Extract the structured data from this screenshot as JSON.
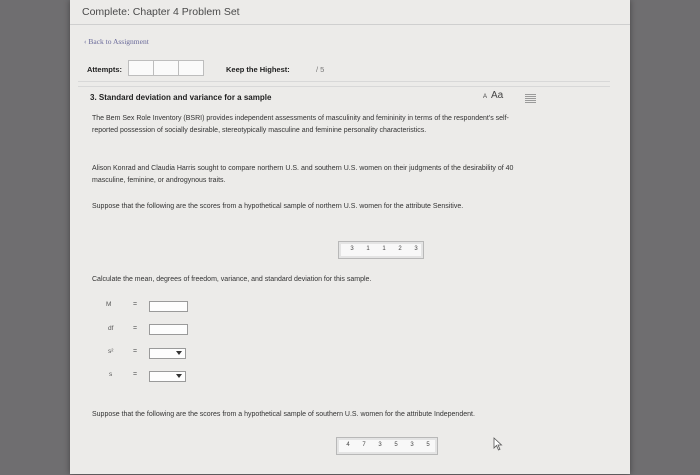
{
  "header": {
    "title": "Complete: Chapter 4 Problem Set"
  },
  "nav": {
    "back_link": "‹ Back to Assignment"
  },
  "attempts": {
    "label": "Attempts:",
    "keep_label": "Keep the Highest:",
    "keep_value": "/ 5"
  },
  "problem": {
    "title": "3. Standard deviation and variance for a sample",
    "font_small": "A",
    "font_large": "Aa",
    "para1": "The Bem Sex Role Inventory (BSRI) provides independent assessments of masculinity and femininity in terms of the respondent's self-reported possession of socially desirable, stereotypically masculine and feminine personality characteristics.",
    "para2": "Alison Konrad and Claudia Harris sought to compare northern U.S. and southern U.S. women on their judgments of the desirability of 40 masculine, feminine, or androgynous traits.",
    "para3": "Suppose that the following are the scores from a hypothetical sample of northern U.S. women for the attribute Sensitive.",
    "north_scores": [
      "3",
      "1",
      "1",
      "2",
      "3"
    ],
    "instruction": "Calculate the mean, degrees of freedom, variance, and standard deviation for this sample.",
    "rows": [
      {
        "label": "M",
        "eq": "="
      },
      {
        "label": "df",
        "eq": "="
      },
      {
        "label": "s²",
        "eq": "="
      },
      {
        "label": "s",
        "eq": "="
      }
    ],
    "para4": "Suppose that the following are the scores from a hypothetical sample of southern U.S. women for the attribute Independent.",
    "south_scores": [
      "4",
      "7",
      "3",
      "5",
      "3",
      "5"
    ]
  }
}
